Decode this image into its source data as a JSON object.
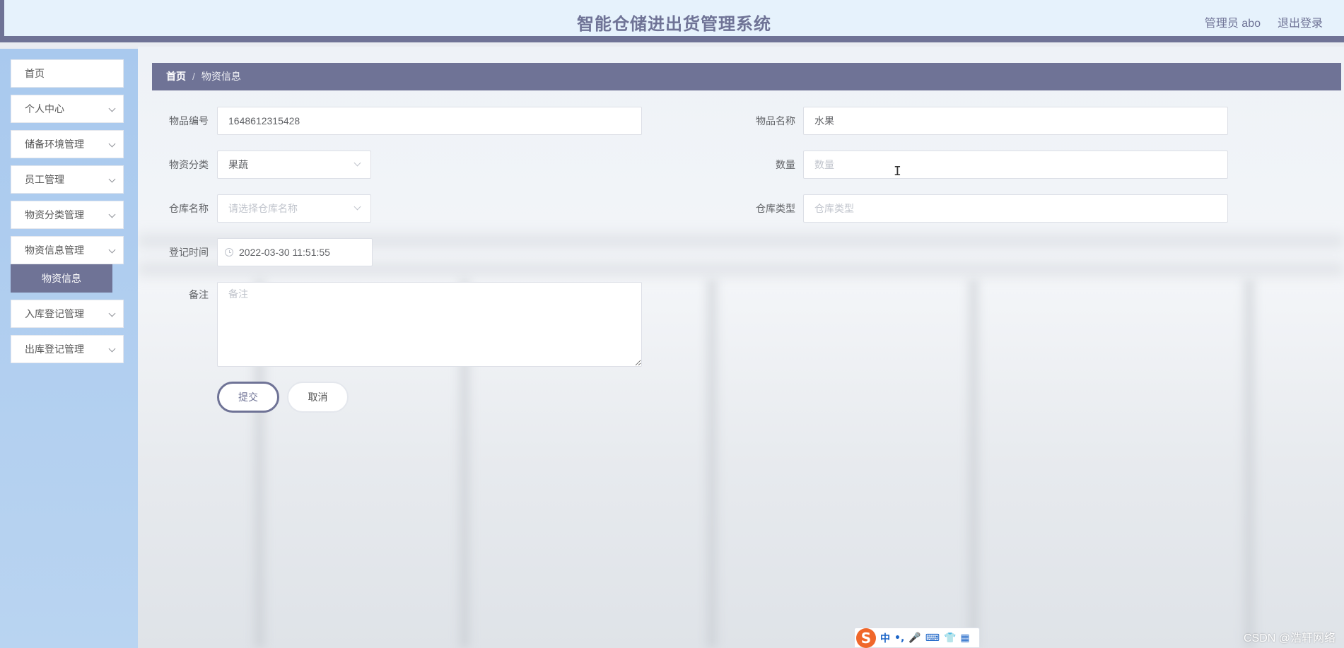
{
  "header": {
    "title": "智能仓储进出货管理系统",
    "user": "管理员 abo",
    "logout": "退出登录"
  },
  "sidebar": {
    "items": [
      {
        "label": "首页",
        "expandable": false
      },
      {
        "label": "个人中心",
        "expandable": true
      },
      {
        "label": "储备环境管理",
        "expandable": true
      },
      {
        "label": "员工管理",
        "expandable": true
      },
      {
        "label": "物资分类管理",
        "expandable": true
      },
      {
        "label": "物资信息管理",
        "expandable": true
      },
      {
        "label": "入库登记管理",
        "expandable": true
      },
      {
        "label": "出库登记管理",
        "expandable": true
      }
    ],
    "active_sub": "物资信息"
  },
  "breadcrumb": {
    "home": "首页",
    "separator": "/",
    "current": "物资信息"
  },
  "form": {
    "item_code": {
      "label": "物品编号",
      "value": "1648612315428"
    },
    "item_name": {
      "label": "物品名称",
      "value": "水果"
    },
    "category": {
      "label": "物资分类",
      "value": "果蔬"
    },
    "quantity": {
      "label": "数量",
      "placeholder": "数量"
    },
    "warehouse_name": {
      "label": "仓库名称",
      "placeholder": "请选择仓库名称"
    },
    "warehouse_type": {
      "label": "仓库类型",
      "placeholder": "仓库类型"
    },
    "register_time": {
      "label": "登记时间",
      "value": "2022-03-30 11:51:55"
    },
    "remark": {
      "label": "备注",
      "placeholder": "备注"
    },
    "submit_label": "提交",
    "cancel_label": "取消"
  },
  "ime_toolbar": {
    "logo": "S",
    "glyphs": [
      "中",
      "•,",
      "🎤",
      "⌨",
      "👕",
      "▦"
    ]
  },
  "watermark": "CSDN @浩轩网络",
  "colors": {
    "accent": "#6f7396",
    "header_bg": "#e6f2fc",
    "sidebar_bg": "#a9c9ee"
  }
}
